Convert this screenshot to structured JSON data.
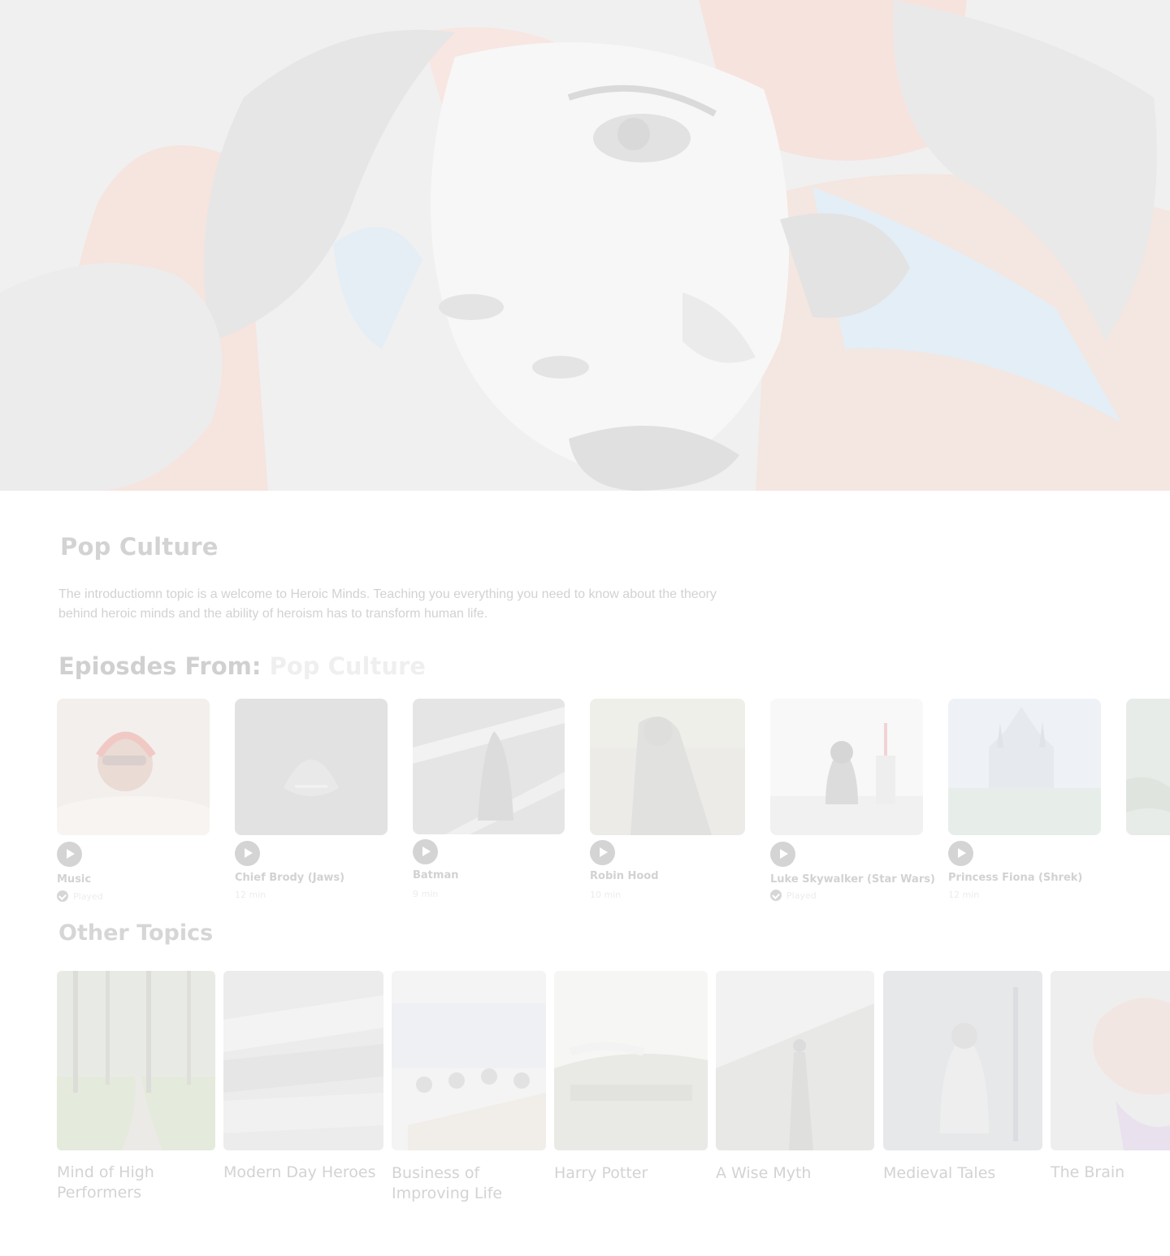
{
  "hero": {
    "image": "pop-art-portrait-mural"
  },
  "topic": {
    "title": "Pop Culture",
    "description": "The introductiomn topic is a welcome to Heroic Minds. Teaching you everything you need to know about the theory behind heroic minds and the ability of heroism has to transform human life."
  },
  "episodes_heading": {
    "prefix": "Epiosdes From:",
    "topic": "Pop Culture"
  },
  "episodes": [
    {
      "title": "Music",
      "meta": "Played",
      "played": true,
      "image": "woman-headphones-clouds"
    },
    {
      "title": "Chief Brody (Jaws)",
      "meta": "12 min",
      "played": false,
      "image": "shark-dark-water"
    },
    {
      "title": "Batman",
      "meta": "9 min",
      "played": false,
      "image": "batman-figure"
    },
    {
      "title": "Robin Hood",
      "meta": "10 min",
      "played": false,
      "image": "statue-figure"
    },
    {
      "title": "Luke Skywalker (Star Wars)",
      "meta": "Played",
      "played": true,
      "image": "lego-darth-vader"
    },
    {
      "title": "Princess Fiona (Shrek)",
      "meta": "12 min",
      "played": false,
      "image": "castle-lake"
    }
  ],
  "other_heading": "Other Topics",
  "other_topics": [
    {
      "label": "Mind of High Performers",
      "image": "forest-path"
    },
    {
      "label": "Modern Day Heroes",
      "image": "newspaper-stack"
    },
    {
      "label": "Business of Improving Life",
      "image": "office-meeting"
    },
    {
      "label": "Harry Potter",
      "image": "viaduct-train"
    },
    {
      "label": "A Wise Myth",
      "image": "statues-building"
    },
    {
      "label": "Medieval Tales",
      "image": "knight-armor"
    },
    {
      "label": "The Brain",
      "image": "brain-illustration"
    }
  ]
}
